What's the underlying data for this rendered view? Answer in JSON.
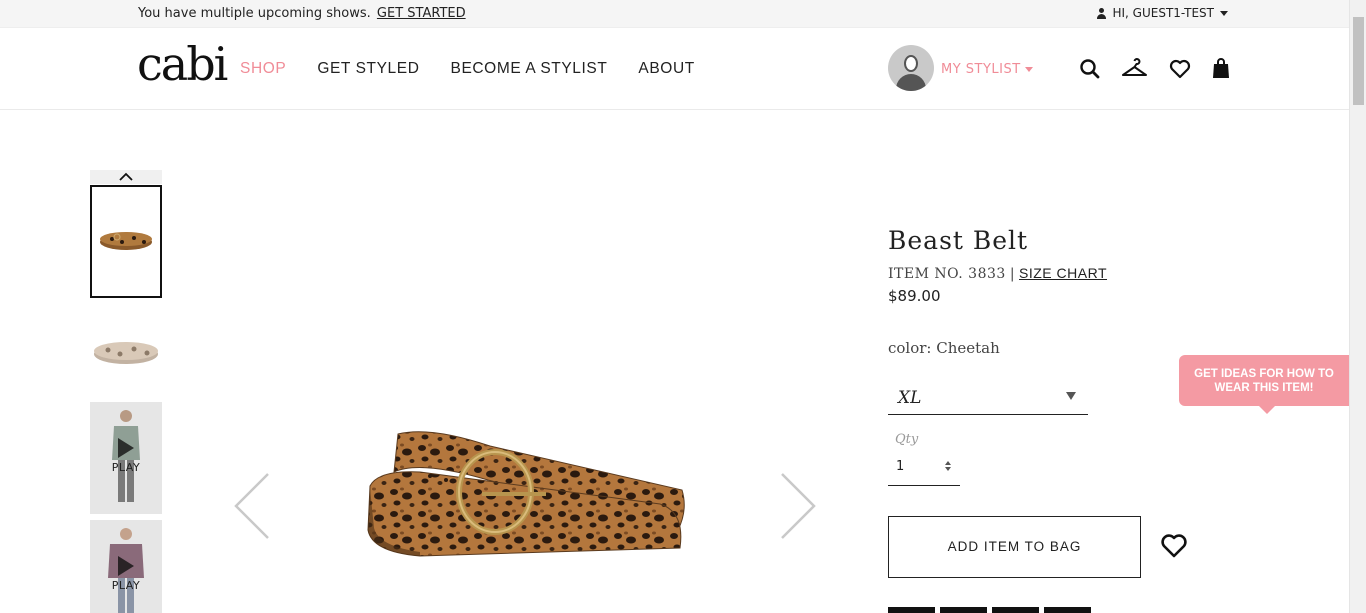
{
  "announcement": {
    "message": "You have multiple upcoming shows.",
    "cta": "GET STARTED"
  },
  "account": {
    "greeting": "HI, GUEST1-TEST"
  },
  "header": {
    "logo": "cabi",
    "nav": [
      {
        "label": "SHOP",
        "active": true
      },
      {
        "label": "GET STYLED",
        "active": false
      },
      {
        "label": "BECOME A STYLIST",
        "active": false
      },
      {
        "label": "ABOUT",
        "active": false
      }
    ],
    "my_stylist": "MY STYLIST",
    "icons": [
      "search-icon",
      "hanger-icon",
      "heart-icon",
      "bag-icon"
    ],
    "accent_color": "#f08c97"
  },
  "gallery": {
    "thumbnails": [
      {
        "type": "image",
        "selected": true
      },
      {
        "type": "image",
        "selected": false
      },
      {
        "type": "video",
        "label": "PLAY"
      },
      {
        "type": "video",
        "label": "PLAY"
      }
    ]
  },
  "product": {
    "title": "Beast Belt",
    "item_no": "ITEM NO. 3833",
    "separator": "|",
    "size_chart": "SIZE CHART",
    "price": "$89.00",
    "color_label": "color: Cheetah",
    "size_selected": "XL",
    "qty_label": "Qty",
    "qty_value": "1",
    "add_to_bag": "ADD ITEM TO BAG"
  },
  "ideas_tab": {
    "line1": "GET IDEAS FOR HOW TO",
    "line2": "WEAR THIS ITEM!"
  }
}
